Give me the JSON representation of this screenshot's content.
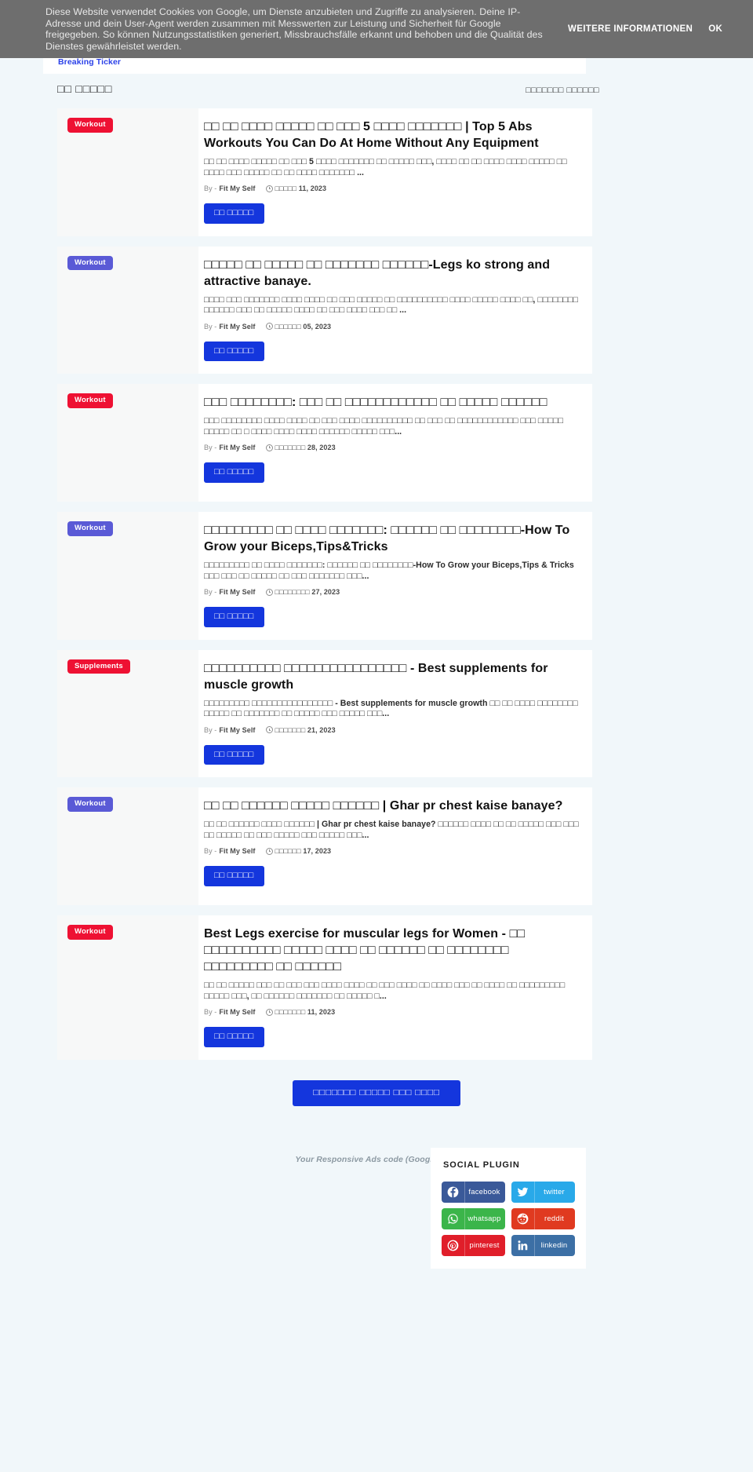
{
  "cookie_banner": {
    "message": "Diese Website verwendet Cookies von Google, um Dienste anzubieten und Zugriffe zu analysieren. Deine IP-Adresse und dein User-Agent werden zusammen mit Messwerten zur Leistung und Sicherheit für Google freigegeben. So können Nutzungsstatistiken generiert, Missbrauchsfälle erkannt und behoben und die Qualität des Dienstes gewährleistet werden.",
    "more_info_label": "WEITERE INFORMATIONEN",
    "ok_label": "OK",
    "background_color": "#6e6e6e"
  },
  "ticker": {
    "label": "Breaking Ticker"
  },
  "section": {
    "title": "□□ □□□□□",
    "view_all_label": "□□□□□□□ □□□□□□"
  },
  "colors": {
    "tag_red": "#ee1133",
    "tag_indigo": "#5a5ad6",
    "button_blue": "#1436dd",
    "page_background": "#f1f7fa",
    "card_background": "#ffffff"
  },
  "posts": [
    {
      "tag": "Workout",
      "tag_color": "#ee1133",
      "title": "□□ □□ □□□□ □□□□□ □□ □□□ 5 □□□□ □□□□□□□ | Top 5 Abs Workouts You Can Do At Home Without Any Equipment",
      "snippet": "□□ □□ □□□□ □□□□□ □□ □□□ 5 □□□□ □□□□□□□ □□ □□□□□ □□□, □□□□ □□ □□ □□□□ □□□□ □□□□□ □□ □□□□ □□□ □□□□□ □□ □□  □□□□ □□□□□□□ ...",
      "by_label": "By -",
      "author": "Fit My Self",
      "date": "□□□□□ 11, 2023",
      "read_more_label": "□□ □□□□□"
    },
    {
      "tag": "Workout",
      "tag_color": "#5a5ad6",
      "title": "□□□□□ □□ □□□□□ □□ □□□□□□□ □□□□□□-Legs ko strong and attractive banaye.",
      "snippet": "□□□□ □□□ □□□□□□□ □□□□ □□□□ □□ □□□ □□□□□ □□ □□□□□□□□□□ □□□□ □□□□□ □□□□ □□, □□□□□□□□ □□□□□□ □□□ □□ □□□□□ □□□□ □□ □□□ □□□□ □□□  □□ ...",
      "by_label": "By -",
      "author": "Fit My Self",
      "date": "□□□□□□ 05, 2023",
      "read_more_label": "□□ □□□□□"
    },
    {
      "tag": "Workout",
      "tag_color": "#ee1133",
      "title": "□□□ □□□□□□□□: □□□ □□ □□□□□□□□□□□□ □□ □□□□□ □□□□□□",
      "snippet": "□□□ □□□□□□□□ □□□□ □□□□ □□ □□□ □□□□ □□□□□□□□□□ □□  □□□ □□ □□□□□□□□□□□□ □□□ □□□□□ □□□□□ □□ □ □□□□ □□□□ □□□□ □□□□□□ □□□□□ □□□...",
      "by_label": "By -",
      "author": "Fit My Self",
      "date": "□□□□□□□ 28, 2023",
      "read_more_label": "□□ □□□□□"
    },
    {
      "tag": "Workout",
      "tag_color": "#5a5ad6",
      "title": "□□□□□□□□□ □□ □□□□ □□□□□□□: □□□□□□ □□ □□□□□□□□-How To Grow your Biceps,Tips&Tricks",
      "snippet": "□□□□□□□□□ □□ □□□□ □□□□□□□: □□□□□□ □□ □□□□□□□□-How To Grow your Biceps,Tips & Tricks  □□□ □□□ □□ □□□□□ □□ □□□ □□□□□□□ □□□...",
      "by_label": "By -",
      "author": "Fit My Self",
      "date": "□□□□□□□□ 27, 2023",
      "read_more_label": "□□ □□□□□"
    },
    {
      "tag": "Supplements",
      "tag_color": "#ee1133",
      "title": "□□□□□□□□□□ □□□□□□□□□□□□□□□□ - Best supplements for muscle growth",
      "snippet": "□□□□□□□□□ □□□□□□□□□□□□□□□□ - Best supplements for muscle growth □□ □□ □□□□ □□□□□□□□ □□□□□ □□ □□□□□□□ □□ □□□□□ □□□ □□□□□  □□□...",
      "by_label": "By -",
      "author": "Fit My Self",
      "date": "□□□□□□□ 21, 2023",
      "read_more_label": "□□ □□□□□"
    },
    {
      "tag": "Workout",
      "tag_color": "#5a5ad6",
      "title": "□□ □□ □□□□□□ □□□□□ □□□□□□ | Ghar pr chest kaise banaye?",
      "snippet": "□□ □□ □□□□□□ □□□□ □□□□□□ | Ghar pr chest kaise banaye? □□□□□□ □□□□ □□ □□ □□□□□ □□□ □□□ □□ □□□□□ □□ □□□ □□□□□ □□□ □□□□□ □□□...",
      "by_label": "By -",
      "author": "Fit My Self",
      "date": "□□□□□□ 17, 2023",
      "read_more_label": "□□ □□□□□"
    },
    {
      "tag": "Workout",
      "tag_color": "#ee1133",
      "title": "Best Legs exercise for muscular legs for Women - □□ □□□□□□□□□□ □□□□□ □□□□ □□ □□□□□□ □□ □□□□□□□□ □□□□□□□□□ □□ □□□□□□",
      "snippet": "□□ □□ □□□□□ □□□ □□ □□□ □□□ □□□□ □□□□ □□  □□□ □□□□ □□ □□□□ □□□ □□ □□□□ □□ □□□□□□□□□ □□□□□ □□□, □□ □□□□□□ □□□□□□□ □□ □□□□□ □...",
      "by_label": "By -",
      "author": "Fit My Self",
      "date": "□□□□□□□ 11, 2023",
      "read_more_label": "□□ □□□□□"
    }
  ],
  "load_more": {
    "label": "□□□□□□□ □□□□□ □□□ □□□□"
  },
  "ads": {
    "placeholder_text": "Your Responsive Ads code (Google Ads)"
  },
  "social_plugin": {
    "title": "SOCIAL PLUGIN",
    "buttons": [
      {
        "label": "facebook",
        "icon": "facebook-icon",
        "color": "#3a5999"
      },
      {
        "label": "twitter",
        "icon": "twitter-icon",
        "color": "#29a9e9"
      },
      {
        "label": "whatsapp",
        "icon": "whatsapp-icon",
        "color": "#3bb54a"
      },
      {
        "label": "reddit",
        "icon": "reddit-icon",
        "color": "#e03a20"
      },
      {
        "label": "pinterest",
        "icon": "pinterest-icon",
        "color": "#e01e2a"
      },
      {
        "label": "linkedin",
        "icon": "linkedin-icon",
        "color": "#3c6fa5"
      }
    ]
  }
}
